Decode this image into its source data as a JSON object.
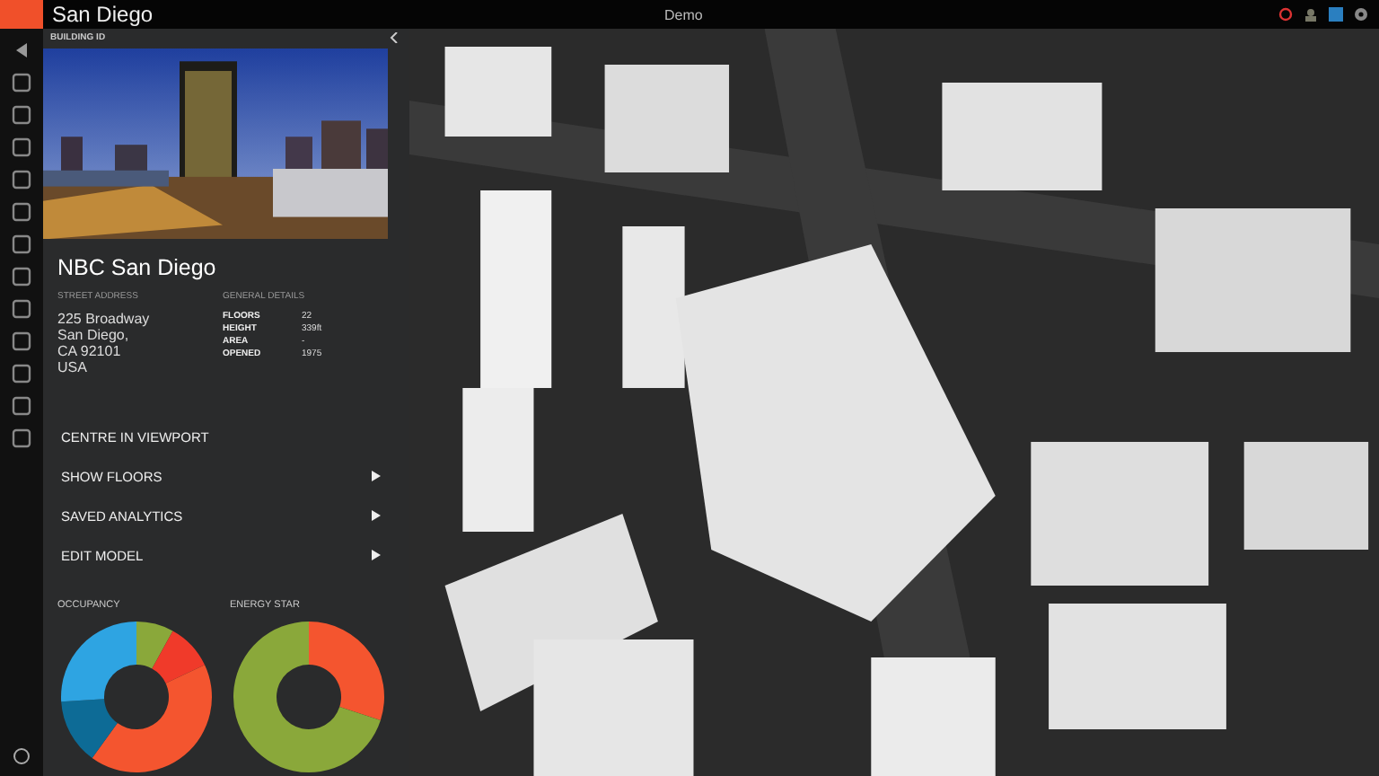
{
  "top_bar": {
    "title": "San Diego",
    "center_title": "Demo"
  },
  "panel": {
    "header": "BUILDING ID",
    "building_name": "NBC San Diego",
    "address": {
      "heading": "STREET ADDRESS",
      "lines": [
        "225 Broadway",
        "San Diego,",
        "CA 92101",
        "USA"
      ]
    },
    "details": {
      "heading": "GENERAL DETAILS",
      "rows": [
        {
          "label": "FLOORS",
          "value": "22"
        },
        {
          "label": "HEIGHT",
          "value": "339ft"
        },
        {
          "label": "AREA",
          "value": "-"
        },
        {
          "label": "OPENED",
          "value": "1975"
        }
      ]
    },
    "actions": [
      {
        "label": "CENTRE IN VIEWPORT",
        "has_submenu": false
      },
      {
        "label": "SHOW FLOORS",
        "has_submenu": true
      },
      {
        "label": "SAVED ANALYTICS",
        "has_submenu": true
      },
      {
        "label": "EDIT MODEL",
        "has_submenu": true
      }
    ],
    "charts": [
      {
        "title": "OCCUPANCY"
      },
      {
        "title": "ENERGY STAR"
      }
    ]
  }
}
